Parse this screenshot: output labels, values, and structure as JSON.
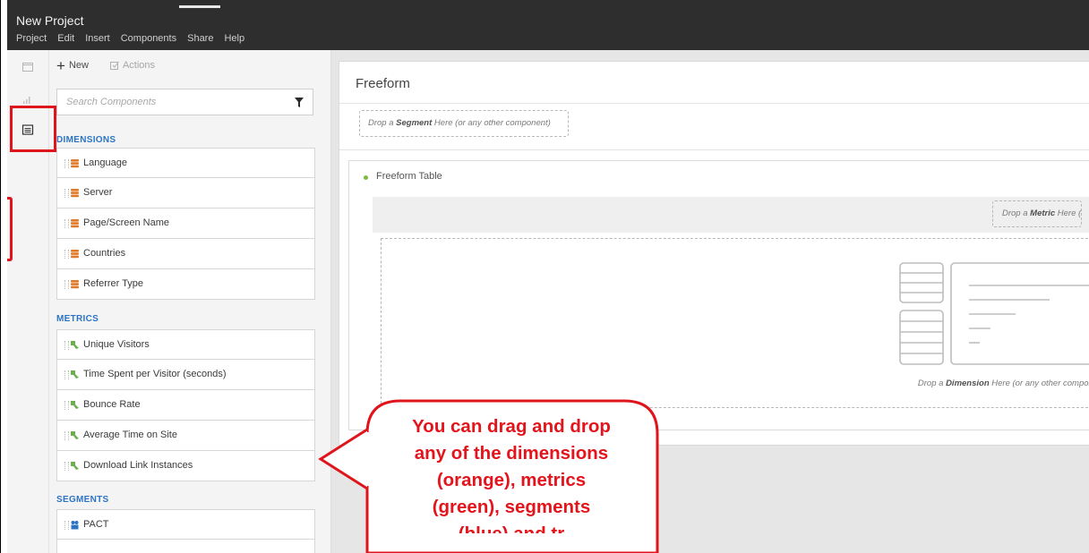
{
  "app": {
    "title": "New Project",
    "menu": [
      "Project",
      "Edit",
      "Insert",
      "Components",
      "Share",
      "Help"
    ]
  },
  "rail": {
    "icons": [
      "panel-icon",
      "visualization-icon",
      "components-icon"
    ]
  },
  "panel": {
    "new_label": "New",
    "actions_label": "Actions",
    "search_placeholder": "Search Components",
    "sections": {
      "dimensions": {
        "label": "DIMENSIONS",
        "color": "#e07a28",
        "items": [
          "Language",
          "Server",
          "Page/Screen Name",
          "Countries",
          "Referrer Type"
        ]
      },
      "metrics": {
        "label": "METRICS",
        "color": "#6ab04c",
        "items": [
          "Unique Visitors",
          "Time Spent per Visitor (seconds)",
          "Bounce Rate",
          "Average Time on Site",
          "Download Link Instances"
        ]
      },
      "segments": {
        "label": "SEGMENTS",
        "color": "#2c74c3",
        "items": [
          "PACT"
        ]
      }
    }
  },
  "workspace": {
    "panel_title": "Freeform",
    "segment_drop": {
      "prefix": "Drop a ",
      "bold": "Segment",
      "suffix": " Here (or any other component)"
    },
    "table_title": "Freeform Table",
    "metric_drop": {
      "prefix": "Drop a ",
      "bold": "Metric",
      "suffix": " Here ("
    },
    "dimension_drop": {
      "prefix": "Drop a ",
      "bold": "Dimension",
      "suffix": " Here (or any other component"
    }
  },
  "callout": {
    "lines": [
      "You can drag and drop",
      "any of the dimensions",
      "(orange), metrics",
      "(green), segments",
      "(blue) and tr"
    ],
    "color": "#e3141b"
  }
}
